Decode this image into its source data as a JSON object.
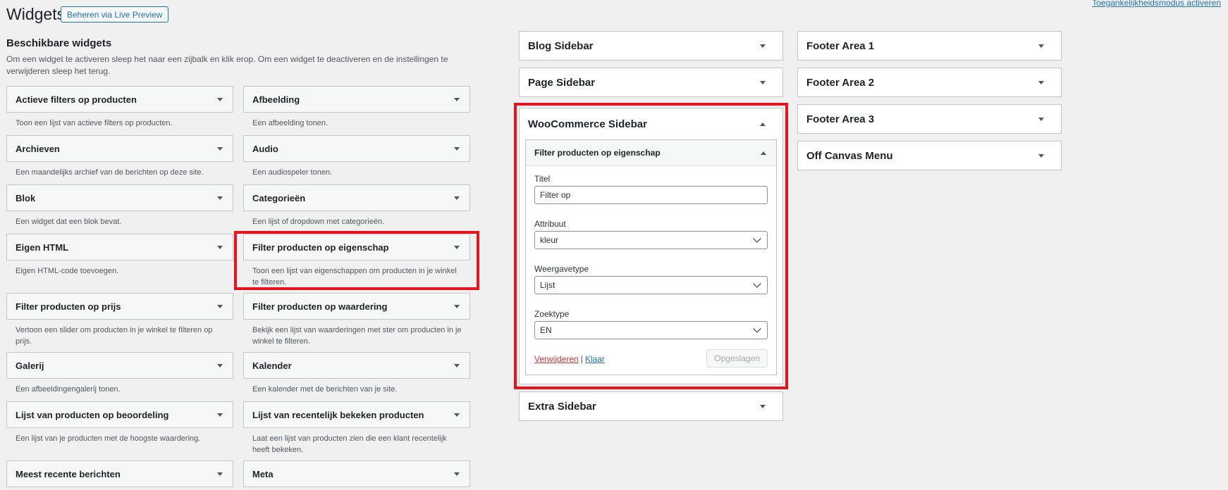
{
  "header": {
    "title": "Widgets",
    "live_preview_button": "Beheren via Live Preview",
    "accessibility_link": "Toegankelijkheidsmodus activeren"
  },
  "available": {
    "title": "Beschikbare widgets",
    "description": "Om een widget te activeren sleep het naar een zijbalk en klik erop. Om een widget te deactiveren en de instellingen te verwijderen sleep het terug.",
    "widgets": [
      {
        "name": "Actieve filters op producten",
        "desc": "Toon een lijst van actieve filters op producten."
      },
      {
        "name": "Afbeelding",
        "desc": "Een afbeelding tonen."
      },
      {
        "name": "Archieven",
        "desc": "Een maandelijks archief van de berichten op deze site."
      },
      {
        "name": "Audio",
        "desc": "Een audiospeler tonen."
      },
      {
        "name": "Blok",
        "desc": "Een widget dat een blok bevat."
      },
      {
        "name": "Categorieën",
        "desc": "Een lijst of dropdown met categorieën."
      },
      {
        "name": "Eigen HTML",
        "desc": "Eigen HTML-code toevoegen."
      },
      {
        "name": "Filter producten op eigenschap",
        "desc": "Toon een lijst van eigenschappen om producten in je winkel te filteren."
      },
      {
        "name": "Filter producten op prijs",
        "desc": "Vertoon een slider om producten in je winkel te filteren op prijs."
      },
      {
        "name": "Filter producten op waardering",
        "desc": "Bekijk een lijst van waarderingen met ster om producten in je winkel te filteren."
      },
      {
        "name": "Galerij",
        "desc": "Een afbeeldingengalerij tonen."
      },
      {
        "name": "Kalender",
        "desc": "Een kalender met de berichten van je site."
      },
      {
        "name": "Lijst van producten op beoordeling",
        "desc": "Een lijst van je producten met de hoogste waardering."
      },
      {
        "name": "Lijst van recentelijk bekeken producten",
        "desc": "Laat een lijst van producten zien die een klant recentelijk heeft bekeken."
      },
      {
        "name": "Meest recente berichten",
        "desc": ""
      },
      {
        "name": "Meta",
        "desc": ""
      }
    ]
  },
  "sidebars_col1": {
    "blog": "Blog Sidebar",
    "page": "Page Sidebar",
    "woocommerce": "WooCommerce Sidebar",
    "extra": "Extra Sidebar"
  },
  "sidebars_col2": [
    "Footer Area 1",
    "Footer Area 2",
    "Footer Area 3",
    "Off Canvas Menu"
  ],
  "open_widget": {
    "title": "Filter producten op eigenschap",
    "fields": {
      "title_label": "Titel",
      "title_value": "Filter op",
      "attribute_label": "Attribuut",
      "attribute_value": "kleur",
      "display_label": "Weergavetype",
      "display_value": "Lijst",
      "query_label": "Zoektype",
      "query_value": "EN"
    },
    "delete_link": "Verwijderen",
    "separator": "|",
    "done_link": "Klaar",
    "save_button": "Opgeslagen"
  },
  "colors": {
    "highlight": "#e8131f",
    "link": "#2271b1",
    "delete": "#d63638",
    "background": "#f0f0f1"
  }
}
